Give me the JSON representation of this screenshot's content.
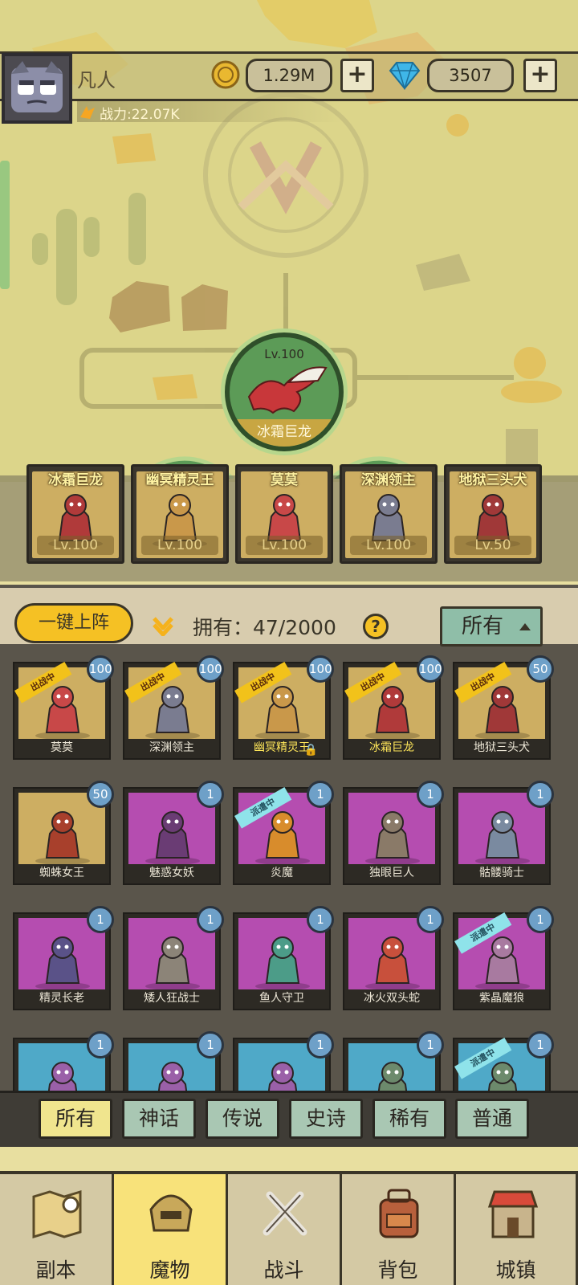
{
  "player": {
    "name": "凡人",
    "power": "战力:22.07K",
    "gold": "1.29M",
    "gems": "3507",
    "plus": "+"
  },
  "stage": {
    "main_level": "Lv.100",
    "main_name": "冰霜巨龙"
  },
  "team": [
    {
      "name": "冰霜巨龙",
      "level": "Lv.100"
    },
    {
      "name": "幽冥精灵王",
      "level": "Lv.100"
    },
    {
      "name": "莫莫",
      "level": "Lv.100"
    },
    {
      "name": "深渊领主",
      "level": "Lv.100"
    },
    {
      "name": "地狱三头犬",
      "level": "Lv.50"
    }
  ],
  "toolbar": {
    "deploy_label": "一键上阵",
    "owned_label": "拥有：47/2000",
    "help": "?",
    "sort_label": "所有"
  },
  "tags": {
    "fighting": "出战中",
    "dispatched": "派遣中"
  },
  "monsters": [
    {
      "name": "莫莫",
      "level": "100",
      "tag": "fight",
      "color": "#cdae62"
    },
    {
      "name": "深渊领主",
      "level": "100",
      "tag": "fight",
      "color": "#cdae62"
    },
    {
      "name": "幽冥精灵王",
      "level": "100",
      "tag": "fight",
      "color": "#cdae62",
      "locked": true
    },
    {
      "name": "冰霜巨龙",
      "level": "100",
      "tag": "fight",
      "color": "#cdae62"
    },
    {
      "name": "地狱三头犬",
      "level": "50",
      "tag": "fight",
      "color": "#cdae62"
    },
    {
      "name": "蜘蛛女王",
      "level": "50",
      "tag": "",
      "color": "#cdae62"
    },
    {
      "name": "魅惑女妖",
      "level": "1",
      "tag": "",
      "color": "#b54db0"
    },
    {
      "name": "炎魔",
      "level": "1",
      "tag": "sent",
      "color": "#b54db0"
    },
    {
      "name": "独眼巨人",
      "level": "1",
      "tag": "",
      "color": "#b54db0"
    },
    {
      "name": "骷髅骑士",
      "level": "1",
      "tag": "",
      "color": "#b54db0"
    },
    {
      "name": "精灵长老",
      "level": "1",
      "tag": "",
      "color": "#b54db0"
    },
    {
      "name": "矮人狂战士",
      "level": "1",
      "tag": "",
      "color": "#b54db0"
    },
    {
      "name": "鱼人守卫",
      "level": "1",
      "tag": "",
      "color": "#b54db0"
    },
    {
      "name": "冰火双头蛇",
      "level": "1",
      "tag": "",
      "color": "#b54db0"
    },
    {
      "name": "紫晶魔狼",
      "level": "1",
      "tag": "sent",
      "color": "#b54db0"
    },
    {
      "name": "",
      "level": "1",
      "tag": "",
      "color": "#4fa9c8"
    },
    {
      "name": "",
      "level": "1",
      "tag": "",
      "color": "#4fa9c8"
    },
    {
      "name": "",
      "level": "1",
      "tag": "",
      "color": "#4fa9c8"
    },
    {
      "name": "",
      "level": "1",
      "tag": "",
      "color": "#4fa9c8"
    },
    {
      "name": "",
      "level": "1",
      "tag": "sent",
      "color": "#4fa9c8"
    }
  ],
  "rarity_tabs": [
    "所有",
    "神话",
    "传说",
    "史诗",
    "稀有",
    "普通"
  ],
  "nav": [
    "副本",
    "魔物",
    "战斗",
    "背包",
    "城镇"
  ]
}
